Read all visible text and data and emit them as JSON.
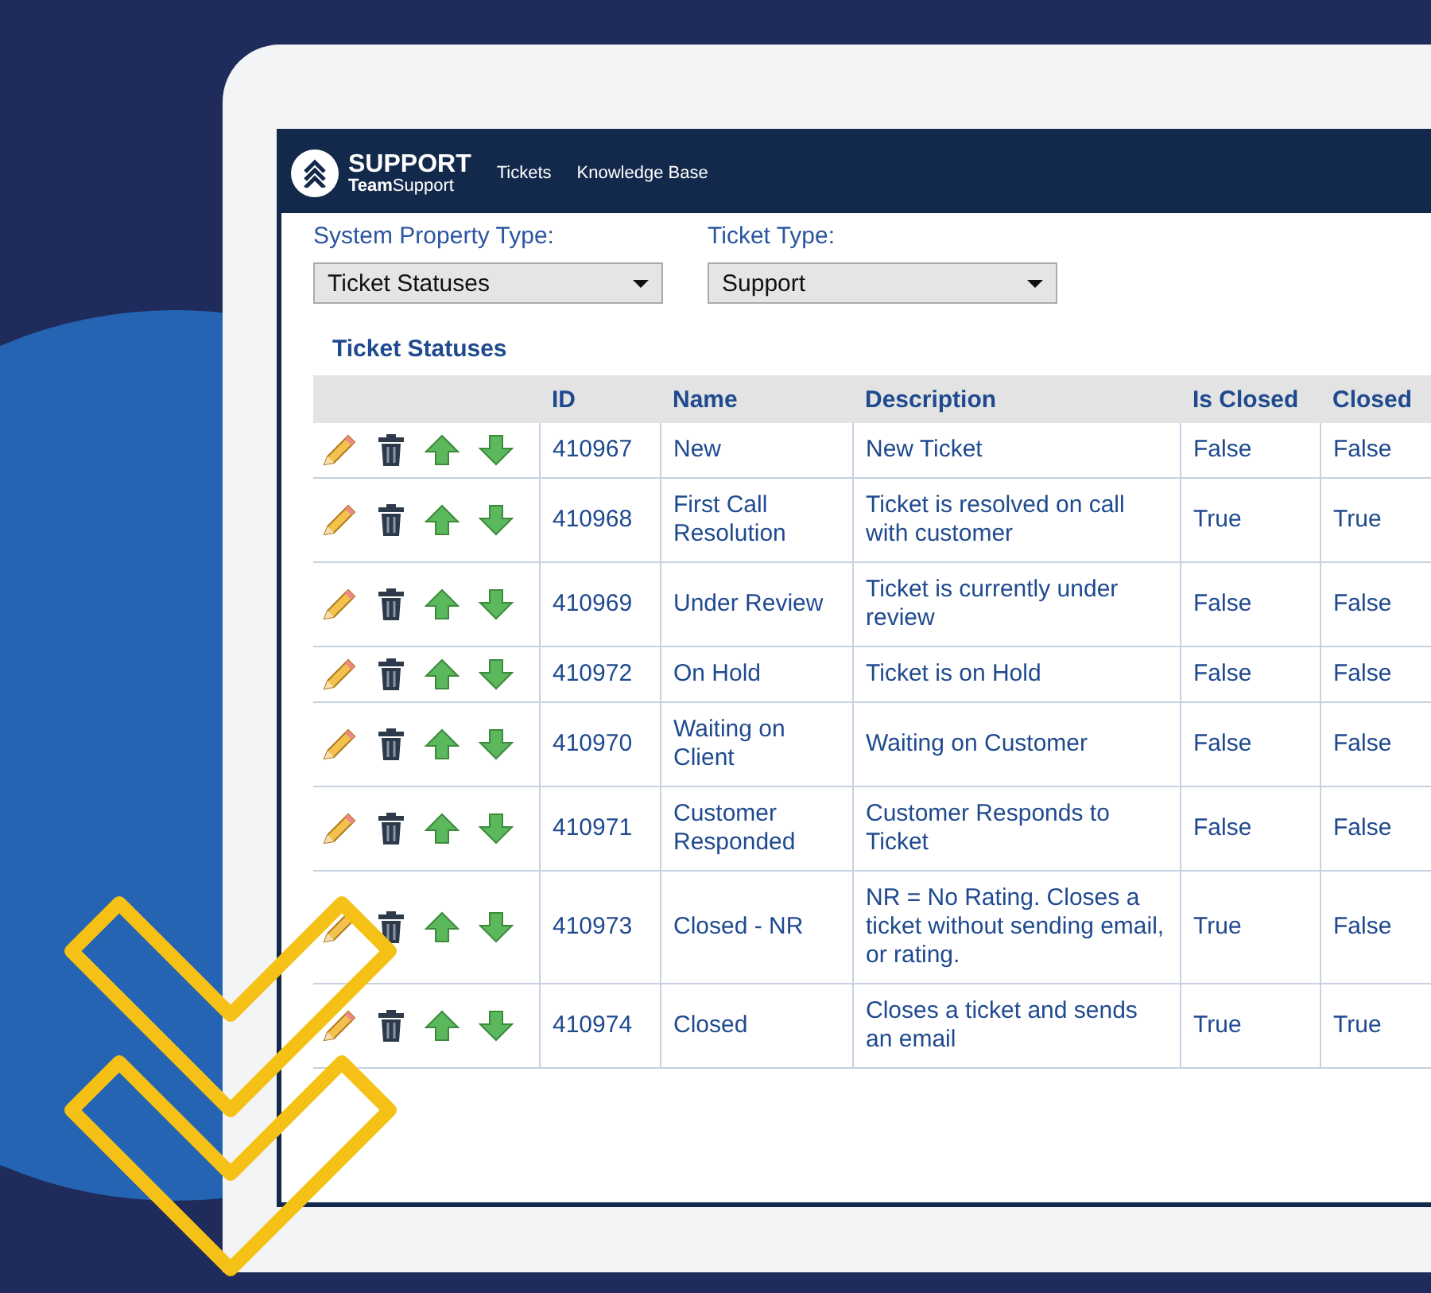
{
  "app": {
    "logo_title": "SUPPORT",
    "logo_subtitle": "**Team**Support",
    "nav": [
      "Tickets",
      "Knowledge Base"
    ]
  },
  "filters": [
    {
      "label": "System Property Type:",
      "value": "Ticket Statuses"
    },
    {
      "label": "Ticket Type:",
      "value": "Support"
    }
  ],
  "section_title": "Ticket Statuses",
  "table": {
    "columns": [
      "ID",
      "Name",
      "Description",
      "Is Closed",
      "Closed"
    ],
    "rows": [
      {
        "id": "410967",
        "name": "New",
        "description": "New Ticket",
        "is_closed": "False",
        "closed": "False"
      },
      {
        "id": "410968",
        "name": "First Call Resolution",
        "description": "Ticket is resolved on call with customer",
        "is_closed": "True",
        "closed": "True"
      },
      {
        "id": "410969",
        "name": "Under Review",
        "description": "Ticket is currently under review",
        "is_closed": "False",
        "closed": "False"
      },
      {
        "id": "410972",
        "name": "On Hold",
        "description": "Ticket is on Hold",
        "is_closed": "False",
        "closed": "False"
      },
      {
        "id": "410970",
        "name": "Waiting on Client",
        "description": "Waiting on Customer",
        "is_closed": "False",
        "closed": "False"
      },
      {
        "id": "410971",
        "name": "Customer Responded",
        "description": "Customer Responds to Ticket",
        "is_closed": "False",
        "closed": "False"
      },
      {
        "id": "410973",
        "name": "Closed - NR",
        "description": "NR = No Rating. Closes a ticket without sending email, or rating.",
        "is_closed": "True",
        "closed": "False"
      },
      {
        "id": "410974",
        "name": "Closed",
        "description": "Closes a ticket and sends an email",
        "is_closed": "True",
        "closed": "True"
      }
    ]
  }
}
